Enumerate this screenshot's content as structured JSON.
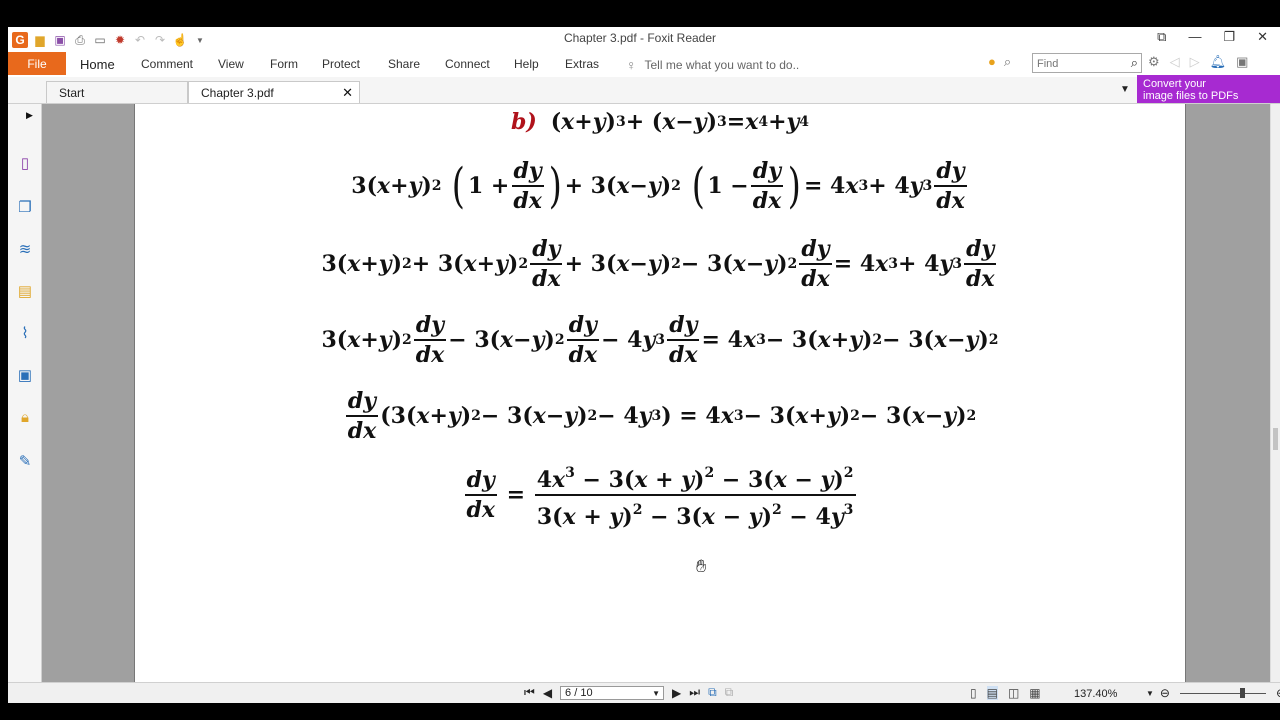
{
  "window": {
    "title": "Chapter 3.pdf - Foxit Reader"
  },
  "ribbon": {
    "file": "File",
    "tabs": [
      "Home",
      "Comment",
      "View",
      "Form",
      "Protect",
      "Share",
      "Connect",
      "Help",
      "Extras"
    ],
    "tell_me": "Tell me what you want to do..",
    "find_placeholder": "Find"
  },
  "doc_tabs": {
    "start": "Start",
    "active": "Chapter 3.pdf"
  },
  "promo": {
    "line1": "Convert your",
    "line2": "image files to PDFs"
  },
  "math": {
    "label": "b)"
  },
  "status": {
    "page": "6 / 10",
    "zoom": "137.40%"
  },
  "colors": {
    "file_tab": "#e8691c",
    "promo": "#a72ad1",
    "label_red": "#b0121b"
  }
}
